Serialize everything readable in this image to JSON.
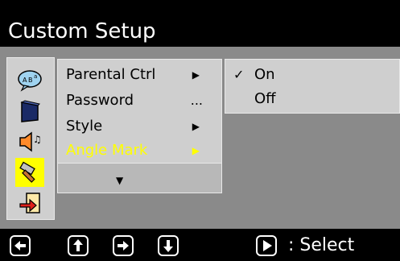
{
  "title": "Custom Setup",
  "icons": [
    {
      "name": "language-bubble-icon",
      "text": "A B a"
    },
    {
      "name": "display-icon"
    },
    {
      "name": "audio-icon",
      "text": "♫"
    },
    {
      "name": "tools-icon",
      "selected": true
    },
    {
      "name": "exit-icon"
    }
  ],
  "menu": {
    "items": [
      {
        "label": "Parental Ctrl",
        "marker": "▶"
      },
      {
        "label": "Password",
        "marker": "..."
      },
      {
        "label": "Style",
        "marker": "▶"
      },
      {
        "label": "Angle Mark",
        "marker": "▶",
        "active": true
      }
    ],
    "more": "▼"
  },
  "submenu": {
    "items": [
      {
        "label": "On",
        "check": "✓"
      },
      {
        "label": "Off",
        "check": ""
      }
    ]
  },
  "controls": {
    "left_icon": "left-arrow-icon",
    "up_icon": "up-arrow-icon",
    "right_icon": "right-arrow-icon",
    "down_icon": "down-arrow-icon",
    "play_icon": "play-icon",
    "select_label": ": Select"
  },
  "colors": {
    "title_bar": "#000000",
    "panel": "#8a8a8a",
    "menu_bg": "#cfcfcf",
    "highlight": "#ffff00",
    "control_bar": "#000000"
  }
}
